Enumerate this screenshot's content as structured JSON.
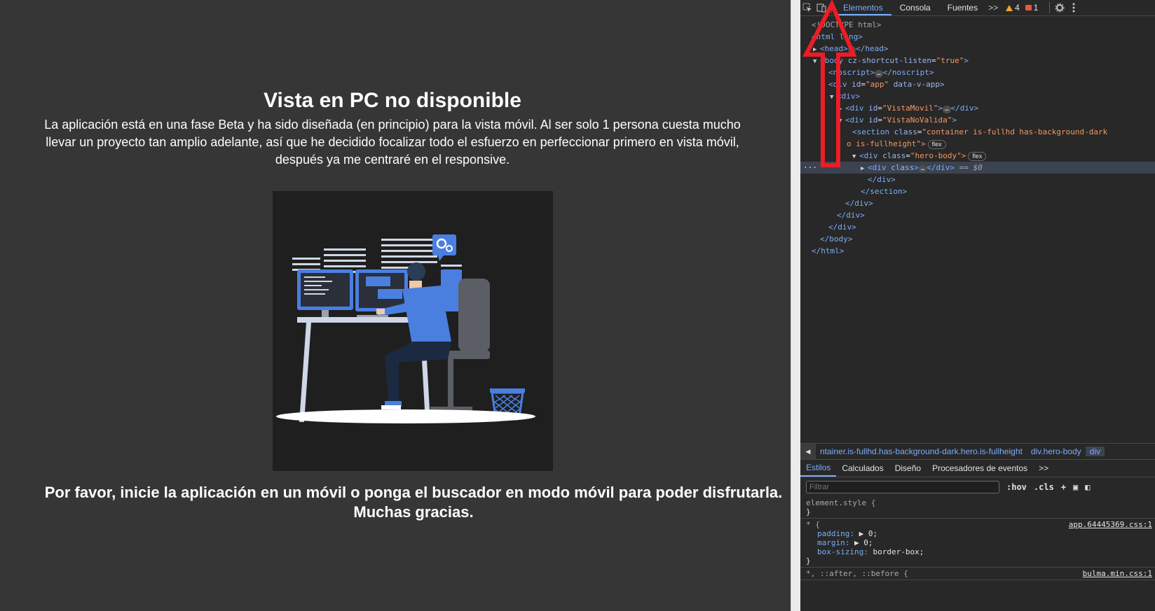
{
  "app": {
    "title": "Vista en PC no disponible",
    "description": "La aplicación está en una fase Beta y ha sido diseñada (en principio) para la vista móvil. Al ser solo 1 persona cuesta mucho llevar un proyecto tan amplio adelante, así que he decidido focalizar todo el esfuerzo en perfeccionar primero en vista móvil, después ya me centraré en el responsive.",
    "please": "Por favor, inicie la aplicación en un móvil o ponga el buscador en modo móvil para poder disfrutarla. Muchas gracias.",
    "colors": {
      "background": "#363636",
      "illustration_bg": "#1f1f1f",
      "accent": "#4a7fe0"
    }
  },
  "devtools": {
    "tabs": [
      "Elementos",
      "Consola",
      "Fuentes"
    ],
    "active_tab": "Elementos",
    "more": ">>",
    "warnings": "4",
    "errors": "1",
    "dom": {
      "doctype": "<!DOCTYPE html>",
      "html_open": "<html lang>",
      "head": "<head>",
      "head_close": "</head>",
      "body_open_tag": "<body",
      "body_attr": "cz-shortcut-listen",
      "body_attr_val": "\"true\"",
      "noscript": "<noscript>",
      "noscript_close": "</noscript>",
      "div_app_tag": "<div",
      "div_app_attr": "id",
      "div_app_val": "\"app\"",
      "div_app_attr2": "data-v-app>",
      "div_plain": "<div>",
      "vista_movil_val": "\"VistaMovil\"",
      "vista_novalida_val": "\"VistaNoValida\"",
      "section_class_val": "\"container is-fullhd has-background-dark",
      "section_class_cont": "o is-fullheight\">",
      "hero_body_val": "\"hero-body\">",
      "div_class": "class",
      "selected_suffix": "== $0",
      "close_div": "</div>",
      "close_section": "</section>",
      "close_body": "</body>",
      "close_html": "</html>",
      "flex_badge": "flex",
      "ellipsis": "…"
    },
    "breadcrumbs": [
      "ntainer.is-fullhd.has-background-dark.hero.is-fullheight",
      "div.hero-body",
      "div"
    ],
    "styles_tabs": [
      "Estilos",
      "Calculados",
      "Diseño",
      "Procesadores de eventos"
    ],
    "filter_placeholder": "Filtrar",
    "filter_tools": [
      ":hov",
      ".cls",
      "+"
    ],
    "rules": {
      "element_style": "element.style {",
      "close_brace": "}",
      "star_selector": "* {",
      "star_source": "app.64445369.css:1",
      "padding": "padding",
      "margin": "margin",
      "box_sizing": "box-sizing",
      "zero": "0;",
      "border_box": "border-box;",
      "pseudo_selector": "*, ::after, ::before {",
      "pseudo_source": "bulma.min.css:1"
    }
  }
}
